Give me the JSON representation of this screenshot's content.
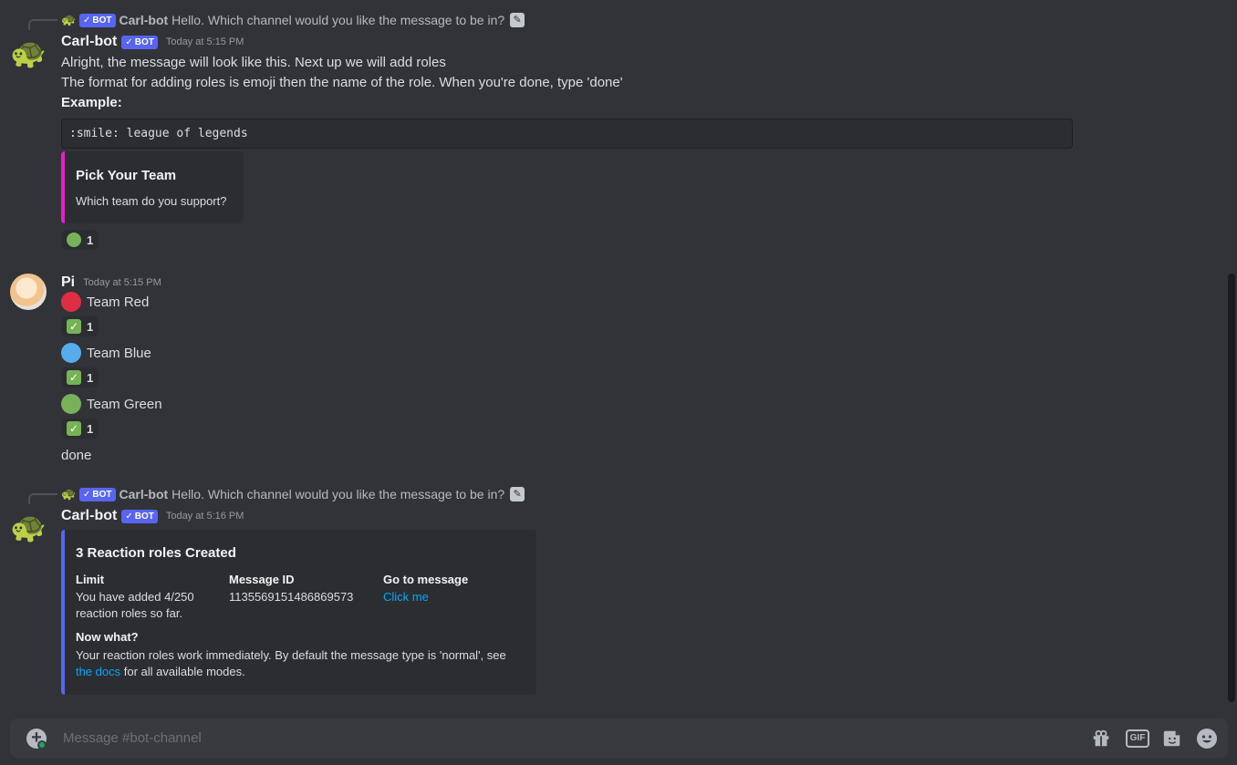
{
  "messages": {
    "first": {
      "reply_name": "Carl-bot",
      "reply_text": "Hello. Which channel would you like the message to be in?",
      "bot_label": "BOT",
      "username": "Carl-bot",
      "timestamp": "Today at 5:15 PM",
      "line1": "Alright, the message will look like this. Next up we will add roles",
      "line2": "The format for adding roles is emoji then the name of the role. When you're done, type 'done'",
      "example_label": "Example:",
      "code": ":smile: league of legends",
      "embed_title": "Pick Your Team",
      "embed_desc": "Which team do you support?",
      "reaction_count": "1"
    },
    "second": {
      "username": "Pi",
      "timestamp": "Today at 5:15 PM",
      "teams": [
        {
          "label": "Team Red",
          "color": "#dd2e44",
          "count": "1"
        },
        {
          "label": "Team Blue",
          "color": "#55acee",
          "count": "1"
        },
        {
          "label": "Team Green",
          "color": "#78b159",
          "count": "1"
        }
      ],
      "done": "done"
    },
    "third": {
      "reply_name": "Carl-bot",
      "reply_text": "Hello. Which channel would you like the message to be in?",
      "bot_label": "BOT",
      "username": "Carl-bot",
      "timestamp": "Today at 5:16 PM",
      "embed_title": "3 Reaction roles Created",
      "fields": {
        "limit_name": "Limit",
        "limit_value_1": "You have added 4/250",
        "limit_value_2": "reaction roles so far.",
        "message_id_name": "Message ID",
        "message_id_value": "1135569151486869573",
        "go_name": "Go to message",
        "go_link": "Click me"
      },
      "now_what_name": "Now what?",
      "now_what_text": "Your reaction roles work immediately. By default the message type is 'normal', see",
      "docs_link": "the docs",
      "now_what_tail": " for all available modes."
    }
  },
  "composer": {
    "placeholder": "Message #bot-channel"
  },
  "colors": {
    "background": "#313338",
    "embed_pink": "#e91ec8",
    "embed_blue": "#5865f2",
    "link": "#00a8fc",
    "bot_tag": "#5865f2"
  }
}
